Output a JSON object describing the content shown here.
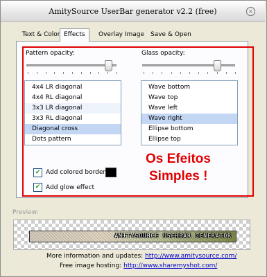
{
  "window": {
    "title": "AmitySource UserBar generator v2.2 (free)",
    "close_glyph": "×"
  },
  "tabs": [
    {
      "label": "Text & Colors"
    },
    {
      "label": "Effects"
    },
    {
      "label": "Overlay Image"
    },
    {
      "label": "Save & Open"
    }
  ],
  "active_tab": "Effects",
  "pattern_opacity": {
    "label": "Pattern opacity:",
    "value_fraction": 0.93,
    "items": [
      "4x4 LR diagonal",
      "4x4 RL diagonal",
      "3x3 LR diagonal",
      "3x3 RL diagonal",
      "Diagonal cross",
      "Dots pattern"
    ],
    "selected": "Diagonal cross"
  },
  "glass_opacity": {
    "label": "Glass opacity:",
    "value_fraction": 0.82,
    "items": [
      "Wave bottom",
      "Wave top",
      "Wave left",
      "Wave right",
      "Ellipse bottom",
      "Ellipse top"
    ],
    "selected": "Wave right"
  },
  "annotation": {
    "line1": "Os Efeitos",
    "line2": "Simples !",
    "color": "#e00000"
  },
  "options": {
    "colored_border": {
      "label": "Add colored border:",
      "checked": true,
      "color": "#000000"
    },
    "glow_effect": {
      "label": "Add glow effect",
      "checked": true
    }
  },
  "preview": {
    "label": "Preview:",
    "userbar_text": "AMITYSOURCE USERBAR GENERATOR"
  },
  "footer": {
    "info_label": "More information and updates:",
    "info_link": "http://www.amitysource.com/",
    "hosting_label": "Free image hosting:",
    "hosting_link": "http://www.sharemyshot.com/"
  },
  "check_glyph": "✔"
}
